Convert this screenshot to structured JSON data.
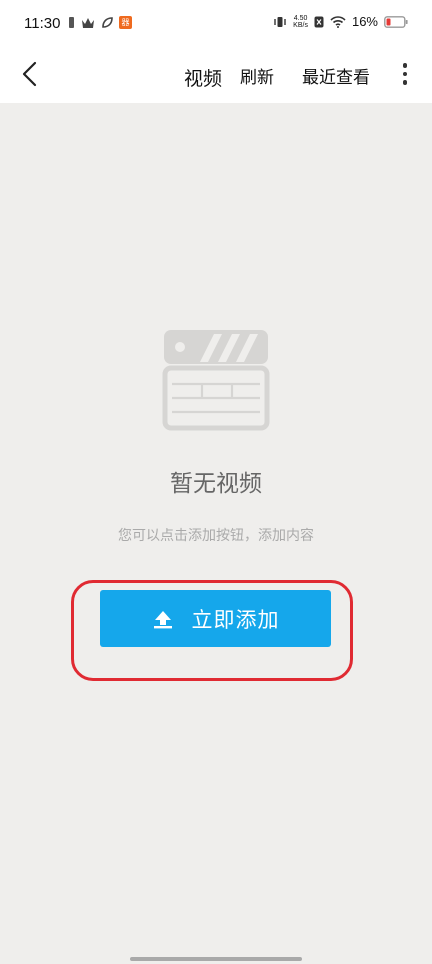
{
  "status_bar": {
    "time": "11:30",
    "net_speed_value": "4.50",
    "net_speed_unit": "KB/s",
    "battery_percent": "16%",
    "badge_text": "器"
  },
  "nav": {
    "title": "视频",
    "refresh_label": "刷新",
    "recent_label": "最近查看"
  },
  "empty_state": {
    "title": "暂无视频",
    "subtitle": "您可以点击添加按钮，添加内容"
  },
  "add_button": {
    "label": "立即添加"
  },
  "colors": {
    "accent": "#15a7eb",
    "highlight": "#e02a32",
    "background": "#efeeec"
  },
  "icons": {
    "back": "chevron-left-icon",
    "more": "more-vertical-icon",
    "upload": "upload-icon",
    "empty": "clapperboard-icon"
  }
}
